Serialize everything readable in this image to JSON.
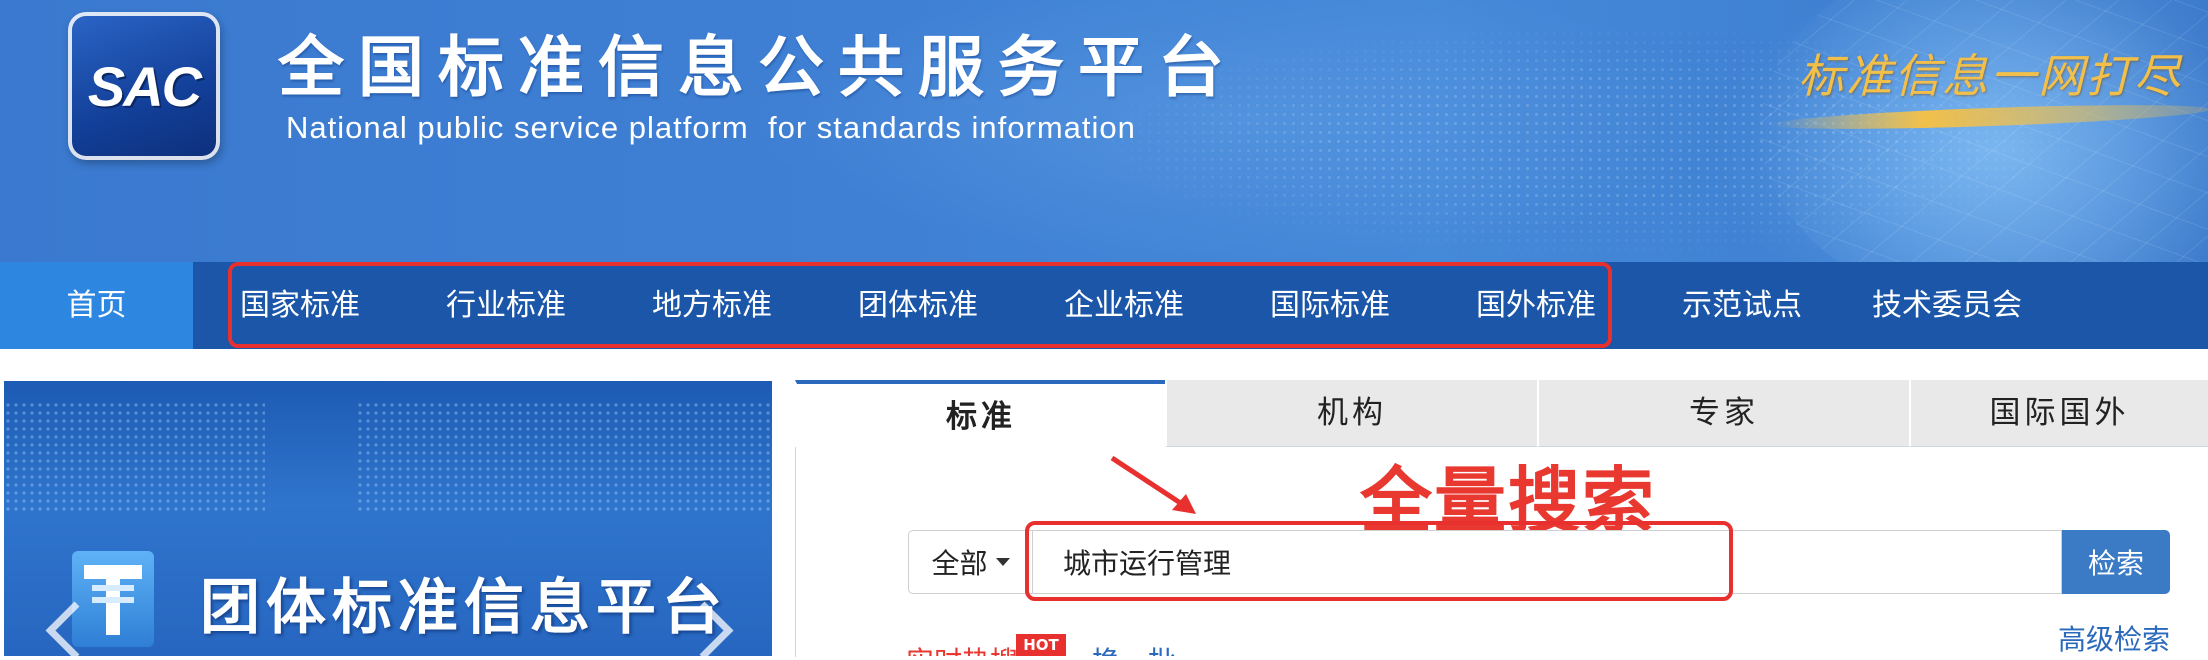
{
  "banner": {
    "logo_text": "SAC",
    "title": "全国标准信息公共服务平台",
    "subtitle": "National public service platform  for standards information",
    "slogan": "标准信息一网打尽"
  },
  "nav": {
    "items": [
      {
        "label": "首页"
      },
      {
        "label": "国家标准"
      },
      {
        "label": "行业标准"
      },
      {
        "label": "地方标准"
      },
      {
        "label": "团体标准"
      },
      {
        "label": "企业标准"
      },
      {
        "label": "国际标准"
      },
      {
        "label": "国外标准"
      },
      {
        "label": "示范试点"
      },
      {
        "label": "技术委员会"
      }
    ]
  },
  "promo": {
    "title": "团体标准信息平台"
  },
  "search": {
    "tabs": [
      {
        "label": "标准"
      },
      {
        "label": "机构"
      },
      {
        "label": "专家"
      },
      {
        "label": "国际国外"
      }
    ],
    "annotation": "全量搜索",
    "scope_value": "全部",
    "query_value": "城市运行管理",
    "button_label": "检索",
    "advanced_label": "高级检索",
    "hot_badge": "HOT",
    "partial_left": "实时热搜",
    "partial_refresh": "换一批"
  },
  "colors": {
    "nav_bg": "#1b56a9",
    "nav_active": "#2d86e0",
    "annotation_red": "#e8302f",
    "button_blue": "#3b7ac5"
  }
}
